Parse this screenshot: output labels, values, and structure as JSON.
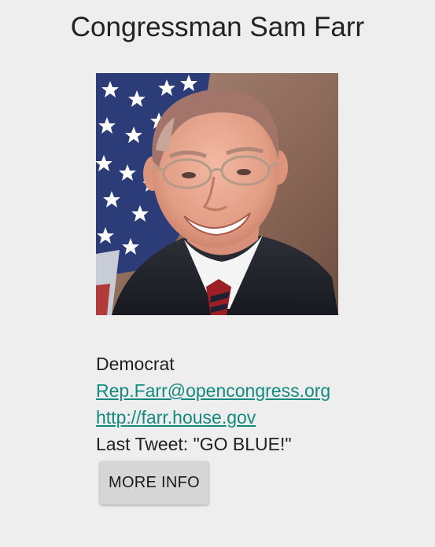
{
  "header": {
    "title": "Congressman Sam Farr"
  },
  "profile": {
    "photo_icon": "portrait-photo",
    "party": "Democrat",
    "email": "Rep.Farr@opencongress.org",
    "website": "http://farr.house.gov",
    "last_tweet": "Last Tweet: \"GO BLUE!\""
  },
  "actions": {
    "more_info_label": "MORE INFO"
  },
  "colors": {
    "background": "#eeeeee",
    "link": "#138a7e",
    "button": "#d6d6d6"
  }
}
